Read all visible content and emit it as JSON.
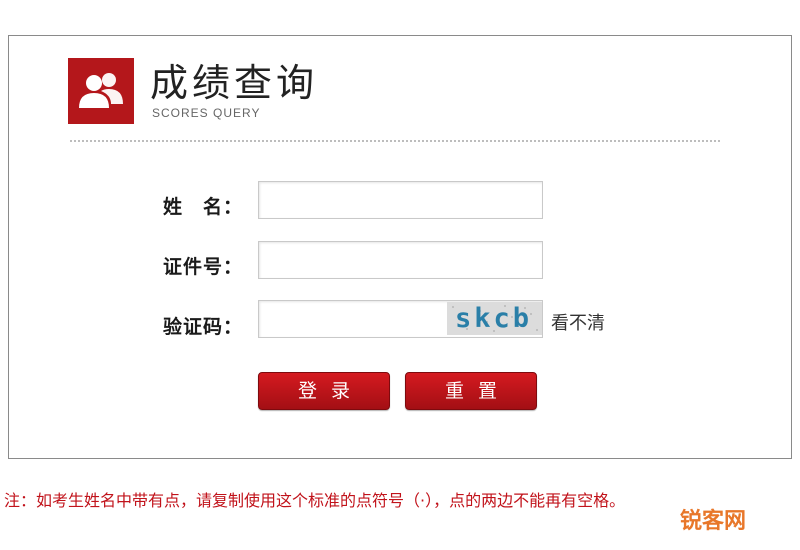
{
  "header": {
    "title": "成绩查询",
    "subtitle": "SCORES QUERY",
    "logo_icon": "users-icon",
    "brand_color": "#b4171b"
  },
  "form": {
    "name_label": "姓　名：",
    "id_label": "证件号：",
    "captcha_label": "验证码：",
    "name_value": "",
    "id_value": "",
    "captcha_value": "",
    "captcha_image_text": "skcb",
    "refresh_link": "看不清",
    "login_button": "登录",
    "reset_button": "重置"
  },
  "note": "注：如考生姓名中带有点，请复制使用这个标准的点符号（·），点的两边不能再有空格。",
  "watermark": "锐客网"
}
